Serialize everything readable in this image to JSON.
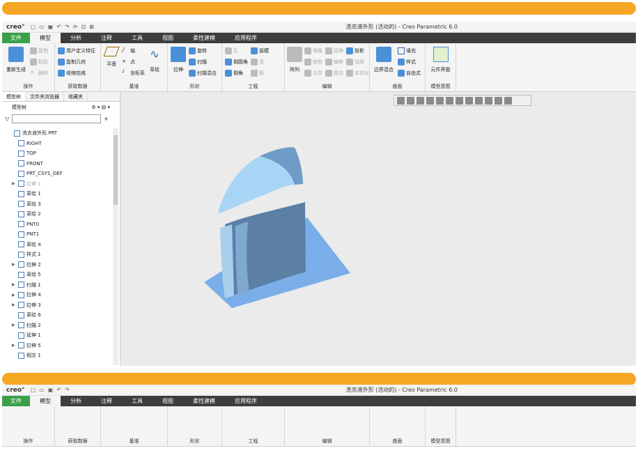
{
  "app": {
    "logo": "creo°",
    "title": "洗衣液外形 (活动的) - Creo Parametric 6.0"
  },
  "menu_tabs": [
    "文件",
    "模型",
    "分析",
    "注释",
    "工具",
    "视图",
    "柔性建模",
    "应用程序"
  ],
  "ribbon": {
    "ops": {
      "regen": "重新生成",
      "copy": "复制",
      "paste": "粘贴",
      "delete": "删除",
      "label": "操作"
    },
    "get_data": {
      "udf": "用户定义特征",
      "copy_geom": "复制几何",
      "shrink": "收缩包络",
      "label": "获取数据"
    },
    "datum": {
      "plane": "平面",
      "axis": "轴",
      "point": "点",
      "csys": "坐标系",
      "sketch": "草绘",
      "label": "基准"
    },
    "shape": {
      "extrude": "拉伸",
      "revolve": "旋转",
      "sweep": "扫描",
      "swept_blend": "扫描混合",
      "label": "形状"
    },
    "engineering": {
      "hole": "孔",
      "round": "倒圆角",
      "chamfer": "倒角",
      "draft": "拔模",
      "shell": "壳",
      "rib": "筋",
      "label": "工程"
    },
    "edit": {
      "pattern": "阵列",
      "mirror": "镜像",
      "trim": "修剪",
      "merge": "合并",
      "extend": "延伸",
      "offset": "偏移",
      "intersect": "相交",
      "project": "投影",
      "thicken": "加厚",
      "solidify": "实体化",
      "label": "编辑"
    },
    "surface": {
      "boundary": "边界混合",
      "fill": "填充",
      "style": "样式",
      "freestyle": "自由式",
      "label": "曲面"
    },
    "intent": {
      "component": "元件界面",
      "label": "模型意图"
    }
  },
  "panel": {
    "tabs": [
      "模型树",
      "文件夹浏览器",
      "收藏夹"
    ],
    "tree_label": "模型树",
    "filter_placeholder": "",
    "items": [
      {
        "label": "洗衣液外形.PRT",
        "icon": "part-icon",
        "exp": ""
      },
      {
        "label": "RIGHT",
        "icon": "datum-plane-icon",
        "exp": ""
      },
      {
        "label": "TOP",
        "icon": "datum-plane-icon",
        "exp": ""
      },
      {
        "label": "FRONT",
        "icon": "datum-plane-icon",
        "exp": ""
      },
      {
        "label": "PRT_CSYS_DEF",
        "icon": "csys-icon",
        "exp": ""
      },
      {
        "label": "拉伸 1",
        "icon": "extrude-icon",
        "exp": "▶",
        "dim": true
      },
      {
        "label": "草绘 1",
        "icon": "sketch-icon",
        "exp": ""
      },
      {
        "label": "草绘 3",
        "icon": "sketch-icon",
        "exp": ""
      },
      {
        "label": "草绘 2",
        "icon": "sketch-icon",
        "exp": ""
      },
      {
        "label": "PNT0",
        "icon": "point-icon",
        "exp": ""
      },
      {
        "label": "PNT1",
        "icon": "point-icon",
        "exp": ""
      },
      {
        "label": "草绘 4",
        "icon": "sketch-icon",
        "exp": ""
      },
      {
        "label": "样式 1",
        "icon": "style-icon",
        "exp": ""
      },
      {
        "label": "拉伸 2",
        "icon": "extrude-icon",
        "exp": "▶"
      },
      {
        "label": "草绘 5",
        "icon": "sketch-icon",
        "exp": ""
      },
      {
        "label": "扫描 1",
        "icon": "sweep-icon",
        "exp": "▶"
      },
      {
        "label": "拉伸 4",
        "icon": "extrude-icon",
        "exp": "▶"
      },
      {
        "label": "拉伸 3",
        "icon": "extrude-icon",
        "exp": "▶"
      },
      {
        "label": "草绘 6",
        "icon": "sketch-icon",
        "exp": ""
      },
      {
        "label": "扫描 2",
        "icon": "sweep-icon",
        "exp": "▶"
      },
      {
        "label": "延伸 1",
        "icon": "extend-icon",
        "exp": ""
      },
      {
        "label": "拉伸 5",
        "icon": "extrude-icon",
        "exp": "▶"
      },
      {
        "label": "相交 1",
        "icon": "intersect-icon",
        "exp": ""
      }
    ]
  },
  "colors": {
    "accent": "#f5a623",
    "file_tab": "#3aa04a",
    "model_top": "#a8d4f5",
    "model_body": "#5b7fa5",
    "plane": "#7aaee8"
  }
}
